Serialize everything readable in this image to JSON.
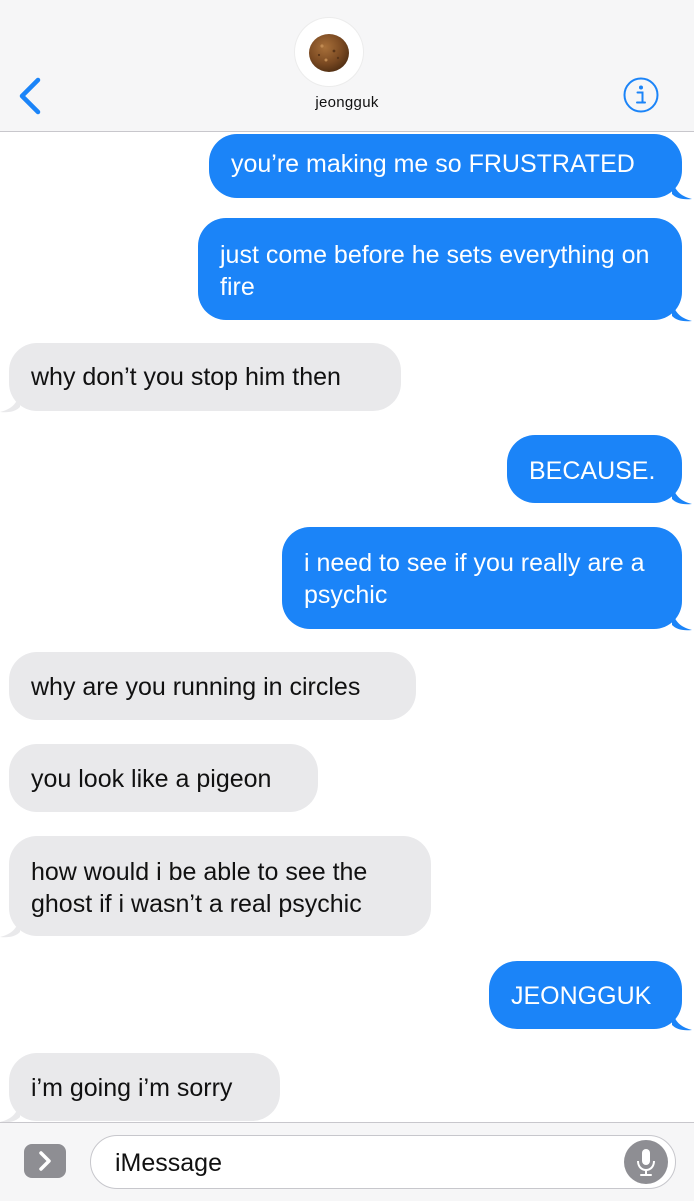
{
  "header": {
    "contact_name": "jeongguk",
    "back_icon": "chevron-left-icon",
    "info_icon": "info-icon",
    "accent_color": "#1b84f8"
  },
  "messages": [
    {
      "direction": "outgoing",
      "text": "you’re making me so FRUSTRATED"
    },
    {
      "direction": "outgoing",
      "text": "just come before he sets everything on fire"
    },
    {
      "direction": "incoming",
      "text": "why don’t you stop him then"
    },
    {
      "direction": "outgoing",
      "text": "BECAUSE."
    },
    {
      "direction": "outgoing",
      "text": "i need to see if you really are a psychic"
    },
    {
      "direction": "incoming",
      "text": "why are you running in circles"
    },
    {
      "direction": "incoming",
      "text": "you look like a pigeon"
    },
    {
      "direction": "incoming",
      "text": "how would i be able to see the ghost if i wasn’t a real psychic"
    },
    {
      "direction": "outgoing",
      "text": "JEONGGUK"
    },
    {
      "direction": "incoming",
      "text": "i’m going i’m sorry"
    }
  ],
  "composer": {
    "placeholder": "iMessage",
    "apps_icon": "chevron-right-icon",
    "mic_icon": "microphone-icon"
  },
  "colors": {
    "outgoing_bubble": "#1b84f8",
    "incoming_bubble": "#e9e9eb",
    "bar_background": "#f6f6f7"
  }
}
